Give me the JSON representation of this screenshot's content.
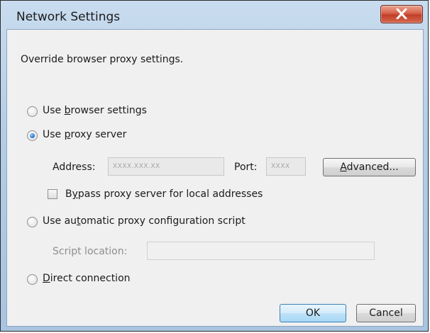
{
  "window": {
    "title": "Network Settings"
  },
  "dialog": {
    "description": "Override browser proxy settings.",
    "options": {
      "browser": {
        "pre": "Use ",
        "ul": "b",
        "post": "rowser settings"
      },
      "proxy": {
        "pre": "Use ",
        "ul": "p",
        "post": "roxy server"
      },
      "auto": {
        "pre": "Use au",
        "ul": "t",
        "post": "omatic proxy configuration script"
      },
      "direct": {
        "pre": "",
        "ul": "D",
        "post": "irect connection"
      }
    },
    "address_label": "Address:",
    "address_value": "XXXX.XXX.XX",
    "port_label": "Port:",
    "port_value": "XXXX",
    "advanced": {
      "pre": "",
      "ul": "A",
      "post": "dvanced..."
    },
    "bypass": {
      "pre": "B",
      "ul": "y",
      "post": "pass proxy server for local addresses"
    },
    "script_label": "Script location:",
    "script_value": "",
    "ok_label": "OK",
    "cancel_label": "Cancel"
  },
  "colors": {
    "close_button": "#c94a33",
    "radio_selected": "#2f7fd6",
    "primary_border": "#3c7fb1"
  }
}
